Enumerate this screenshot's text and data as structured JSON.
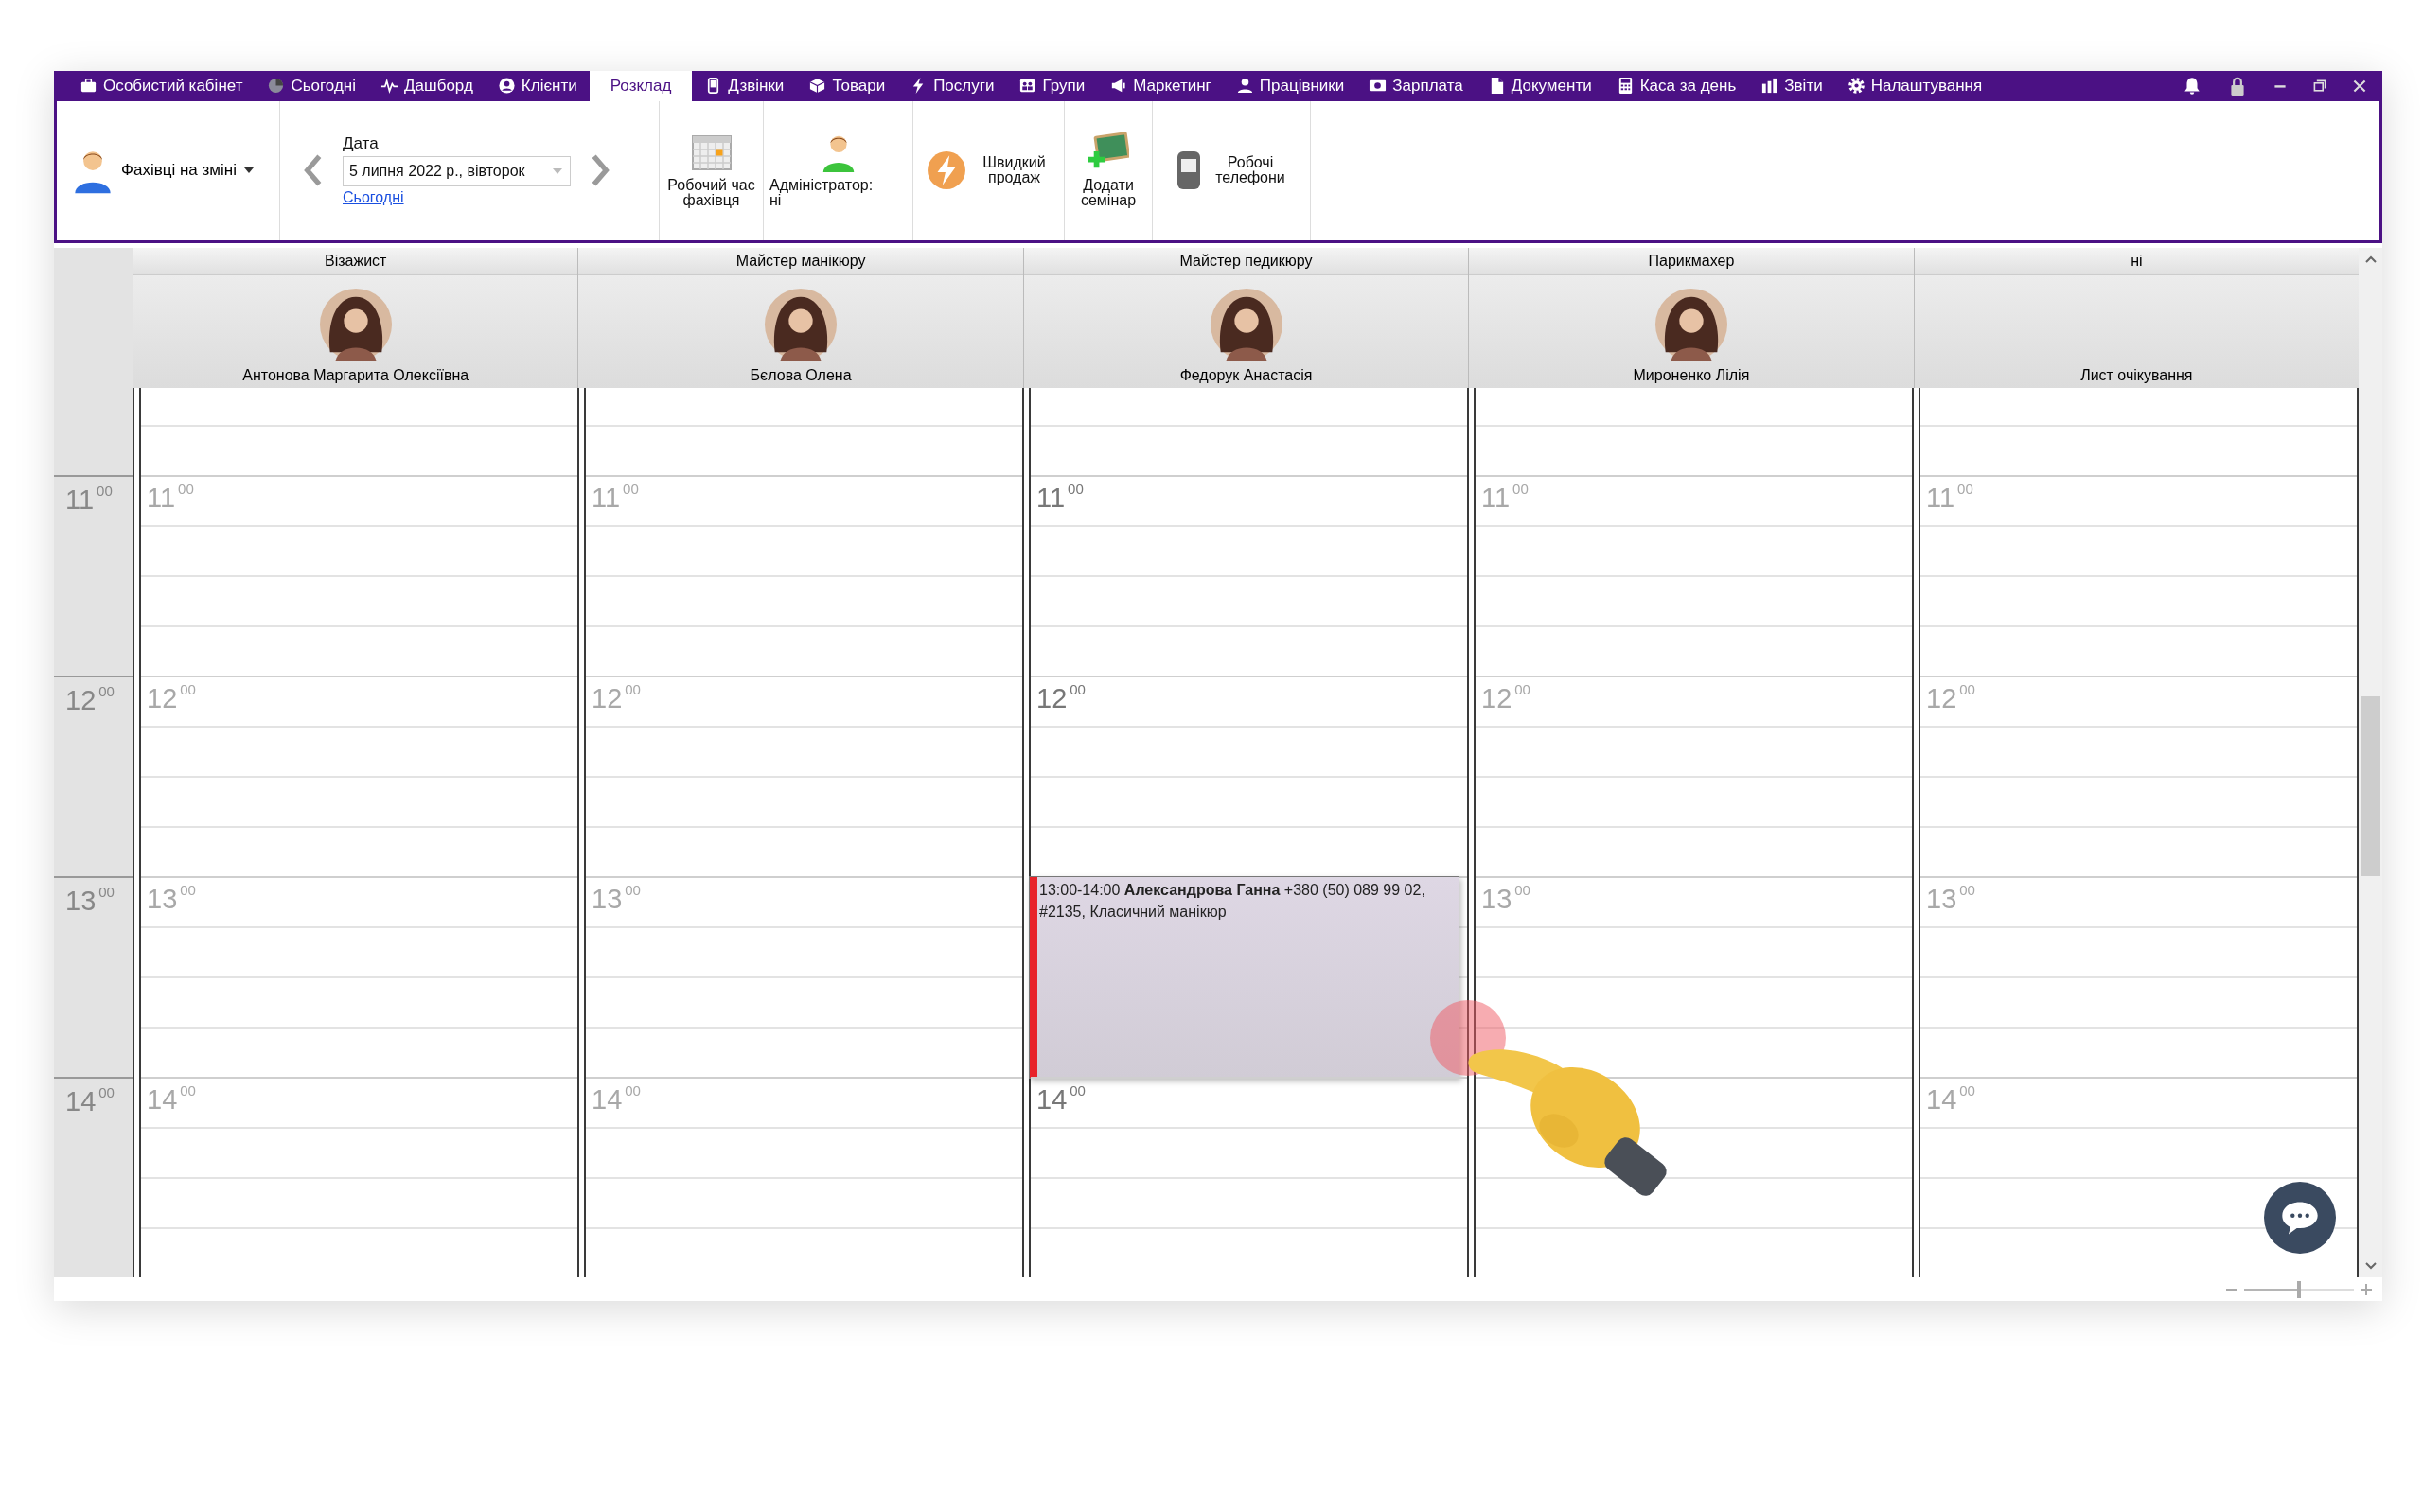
{
  "menu": [
    {
      "label": "Особистий кабінет",
      "selected": false
    },
    {
      "label": "Сьогодні",
      "selected": false
    },
    {
      "label": "Дашборд",
      "selected": false
    },
    {
      "label": "Клієнти",
      "selected": false
    },
    {
      "label": "Розклад",
      "selected": true
    },
    {
      "label": "Дзвінки",
      "selected": false
    },
    {
      "label": "Товари",
      "selected": false
    },
    {
      "label": "Послуги",
      "selected": false
    },
    {
      "label": "Групи",
      "selected": false
    },
    {
      "label": "Маркетинг",
      "selected": false
    },
    {
      "label": "Працівники",
      "selected": false
    },
    {
      "label": "Зарплата",
      "selected": false
    },
    {
      "label": "Документи",
      "selected": false
    },
    {
      "label": "Каса за день",
      "selected": false
    },
    {
      "label": "Звіти",
      "selected": false
    },
    {
      "label": "Налаштування",
      "selected": false
    }
  ],
  "toolbar": {
    "staff_dropdown": {
      "label": "Фахівці на зміні"
    },
    "date": {
      "label": "Дата",
      "value": "5 липня 2022 р., вівторок",
      "today_link": "Сьогодні"
    },
    "buttons": [
      {
        "kind": "schedule",
        "label": "Робочий час фахівця"
      },
      {
        "kind": "admin",
        "label": "Адміністратор:",
        "value": "ні"
      },
      {
        "kind": "quick_sale",
        "label": "Швидкий продаж"
      },
      {
        "kind": "seminar",
        "label": "Додати семінар"
      },
      {
        "kind": "phones",
        "label": "Робочі телефони"
      }
    ]
  },
  "time_column": {
    "hours": [
      {
        "hour": "11",
        "minutes": "00"
      },
      {
        "hour": "12",
        "minutes": "00"
      },
      {
        "hour": "13",
        "minutes": "00"
      },
      {
        "hour": "14",
        "minutes": "00"
      }
    ]
  },
  "columns": [
    {
      "role": "Візажист",
      "name": "Антонова Маргарита Олексіївна",
      "avatar": true,
      "highlighted": false,
      "cells": [
        {
          "kind": "mark",
          "hour": "11",
          "minutes": "00"
        },
        {
          "kind": "mark",
          "hour": "12",
          "minutes": "00"
        },
        {
          "kind": "mark",
          "hour": "13",
          "minutes": "00"
        },
        {
          "kind": "mark",
          "hour": "14",
          "minutes": "00"
        }
      ]
    },
    {
      "role": "Майстер манікюру",
      "name": "Бєлова Олена",
      "avatar": true,
      "highlighted": false,
      "cells": [
        {
          "kind": "mark",
          "hour": "11",
          "minutes": "00"
        },
        {
          "kind": "mark",
          "hour": "12",
          "minutes": "00"
        },
        {
          "kind": "mark",
          "hour": "13",
          "minutes": "00"
        },
        {
          "kind": "mark",
          "hour": "14",
          "minutes": "00"
        }
      ]
    },
    {
      "role": "Майстер педикюру",
      "name": "Федорук Анастасія",
      "avatar": true,
      "highlighted": true,
      "cells": [
        {
          "kind": "mark",
          "hour": "11",
          "minutes": "00"
        },
        {
          "kind": "mark",
          "hour": "12",
          "minutes": "00"
        },
        {
          "kind": "appointment",
          "text": "13:00-14:00 **Александрова Ганна** +380 (50) 089 99 02, #2135, Класичний манікюр",
          "color": "#e8232a"
        },
        {
          "kind": "mark",
          "hour": "14",
          "minutes": "00"
        }
      ]
    },
    {
      "role": "Парикмахер",
      "name": "Мироненко Лілія",
      "avatar": true,
      "highlighted": false,
      "cells": [
        {
          "kind": "mark",
          "hour": "11",
          "minutes": "00"
        },
        {
          "kind": "mark",
          "hour": "12",
          "minutes": "00"
        },
        {
          "kind": "mark",
          "hour": "13",
          "minutes": "00"
        },
        {
          "kind": "covered"
        }
      ]
    },
    {
      "role": "ні",
      "name": "Лист очікування",
      "avatar": false,
      "highlighted": false,
      "cells": [
        {
          "kind": "mark",
          "hour": "11",
          "minutes": "00"
        },
        {
          "kind": "mark",
          "hour": "12",
          "minutes": "00"
        },
        {
          "kind": "mark",
          "hour": "13",
          "minutes": "00"
        },
        {
          "kind": "mark",
          "hour": "14",
          "minutes": "00"
        }
      ]
    }
  ],
  "zoom": {
    "level": 0.5
  }
}
